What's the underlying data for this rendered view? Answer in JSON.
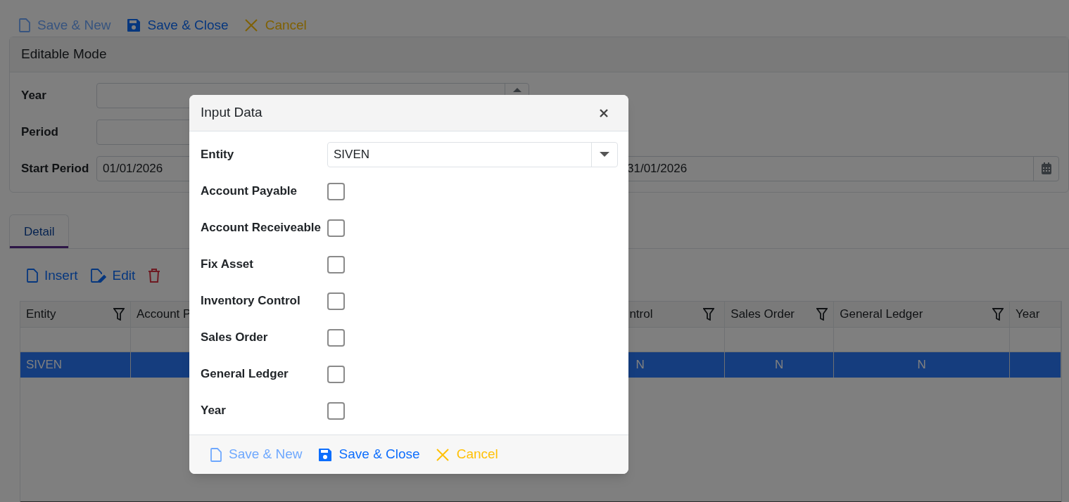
{
  "toolbar": [
    {
      "kind": "new",
      "label": "Save & New",
      "disabled": true
    },
    {
      "kind": "save",
      "label": "Save & Close",
      "disabled": false
    },
    {
      "kind": "cancel",
      "label": "Cancel",
      "disabled": false
    }
  ],
  "panel": {
    "title": "Editable Mode",
    "fields": [
      {
        "label": "Year",
        "kind": "number"
      },
      {
        "label": "Period",
        "kind": "text"
      },
      {
        "label": "Start Period",
        "kind": "daterange",
        "value": "01/01/2026",
        "end_value": "31/01/2026"
      }
    ]
  },
  "tabs": [
    {
      "label": "Detail",
      "selected": true
    }
  ],
  "grid_toolbar": [
    {
      "kind": "insert",
      "label": "Insert"
    },
    {
      "kind": "edit",
      "label": "Edit"
    },
    {
      "kind": "delete"
    }
  ],
  "table": {
    "columns": [
      {
        "label": "Entity",
        "filter": true
      },
      {
        "label": "Account P"
      },
      {
        "label": "ntrol",
        "filter": true
      },
      {
        "label": "Sales Order",
        "filter": true
      },
      {
        "label": "General Ledger",
        "filter": true
      },
      {
        "label": "Year"
      }
    ],
    "rows": [
      {
        "selected": true,
        "cells": [
          "SIVEN",
          "",
          "N",
          "N",
          "N",
          ""
        ]
      }
    ]
  },
  "dialog": {
    "title": "Input Data",
    "entity": {
      "label": "Entity",
      "value": "SIVEN"
    },
    "checks": [
      {
        "label": "Account Payable",
        "checked": false
      },
      {
        "label": "Account Receiveable",
        "checked": false
      },
      {
        "label": "Fix Asset",
        "checked": false
      },
      {
        "label": "Inventory Control",
        "checked": false
      },
      {
        "label": "Sales Order",
        "checked": false
      },
      {
        "label": "General Ledger",
        "checked": false
      },
      {
        "label": "Year",
        "checked": false
      }
    ],
    "buttons": [
      {
        "kind": "new",
        "label": "Save & New",
        "disabled": true
      },
      {
        "kind": "save",
        "label": "Save & Close",
        "disabled": false
      },
      {
        "kind": "cancel",
        "label": "Cancel",
        "disabled": false
      }
    ]
  }
}
